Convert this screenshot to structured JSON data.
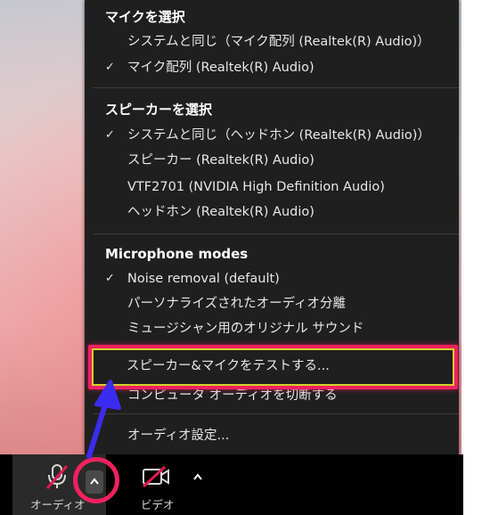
{
  "menu": {
    "mic_section": {
      "title": "マイクを選択",
      "items": [
        {
          "label": "システムと同じ（マイク配列 (Realtek(R) Audio)）",
          "checked": false
        },
        {
          "label": "マイク配列 (Realtek(R) Audio)",
          "checked": true
        }
      ]
    },
    "speaker_section": {
      "title": "スピーカーを選択",
      "items": [
        {
          "label": "システムと同じ（ヘッドホン (Realtek(R) Audio)）",
          "checked": true
        },
        {
          "label": "スピーカー (Realtek(R) Audio)",
          "checked": false
        },
        {
          "label": "VTF2701 (NVIDIA High Definition Audio)",
          "checked": false
        },
        {
          "label": "ヘッドホン (Realtek(R) Audio)",
          "checked": false
        }
      ]
    },
    "mic_modes_section": {
      "title": "Microphone modes",
      "items": [
        {
          "label": "Noise removal (default)",
          "checked": true
        },
        {
          "label": "パーソナライズされたオーディオ分離",
          "checked": false
        },
        {
          "label": "ミュージシャン用のオリジナル サウンド",
          "checked": false
        }
      ]
    },
    "test_item": "スピーカー&マイクをテストする...",
    "switch_computer_audio": "コンピュータ オーディオを切断する",
    "audio_settings": "オーディオ設定...",
    "check_glyph": "✓"
  },
  "toolbar": {
    "audio_label": "オーディオ",
    "video_label": "ビデオ",
    "caret_glyph": "^"
  },
  "colors": {
    "menu_bg": "#1f1f1f",
    "highlight": "#f0215e",
    "arrow": "#3a2cf0",
    "mute_slash": "#e0194f"
  }
}
